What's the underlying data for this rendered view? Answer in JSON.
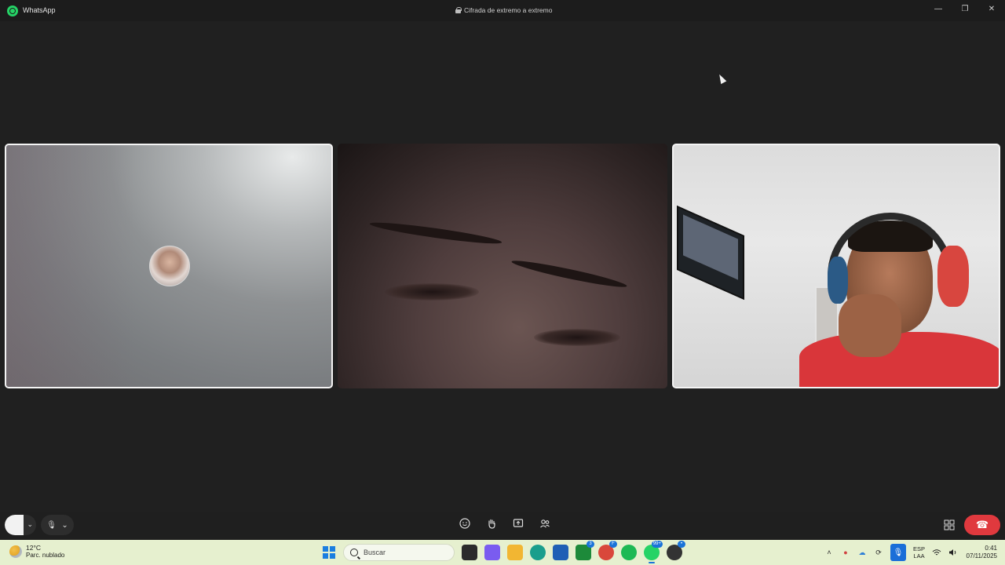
{
  "window": {
    "app_name": "WhatsApp",
    "encryption_label": "Cifrada de extremo a extremo",
    "buttons": {
      "minimize": "—",
      "restore": "❐",
      "close": "✕"
    }
  },
  "call": {
    "participants": [
      {
        "id": "participant-1",
        "state": "camera-off-avatar"
      },
      {
        "id": "participant-2",
        "state": "video"
      },
      {
        "id": "participant-3",
        "state": "video"
      }
    ],
    "controls": {
      "camera_chevron": "⌄",
      "mic_icon": "🎙",
      "mic_chevron": "⌄",
      "center_icons": [
        "emoji-icon",
        "raise-hand-icon",
        "share-screen-icon",
        "participants-icon"
      ],
      "end_call_icon": "☎"
    }
  },
  "taskbar": {
    "weather": {
      "temp": "12°C",
      "desc": "Parc. nublado"
    },
    "search_placeholder": "Buscar",
    "apps": [
      {
        "name": "task-view-icon",
        "color": "#2b2b2b"
      },
      {
        "name": "copilot-icon",
        "color": "#7a5cf0"
      },
      {
        "name": "file-explorer-icon",
        "color": "#f2b632"
      },
      {
        "name": "edge-icon",
        "color": "#1a9e8c"
      },
      {
        "name": "store-icon",
        "color": "#1f5fb5"
      },
      {
        "name": "xbox-icon",
        "color": "#1d8a3a",
        "badge": "3"
      },
      {
        "name": "chrome-icon",
        "color": "#d9483b",
        "badge": "F"
      },
      {
        "name": "spotify-icon",
        "color": "#1db954"
      },
      {
        "name": "whatsapp-icon",
        "color": "#25d366",
        "badge": "99+"
      },
      {
        "name": "app-icon",
        "color": "#333333",
        "badge": "•"
      }
    ],
    "tray": {
      "lang_line1": "ESP",
      "lang_line2": "LAA",
      "time": "0:41",
      "date": "07/11/2025"
    }
  }
}
